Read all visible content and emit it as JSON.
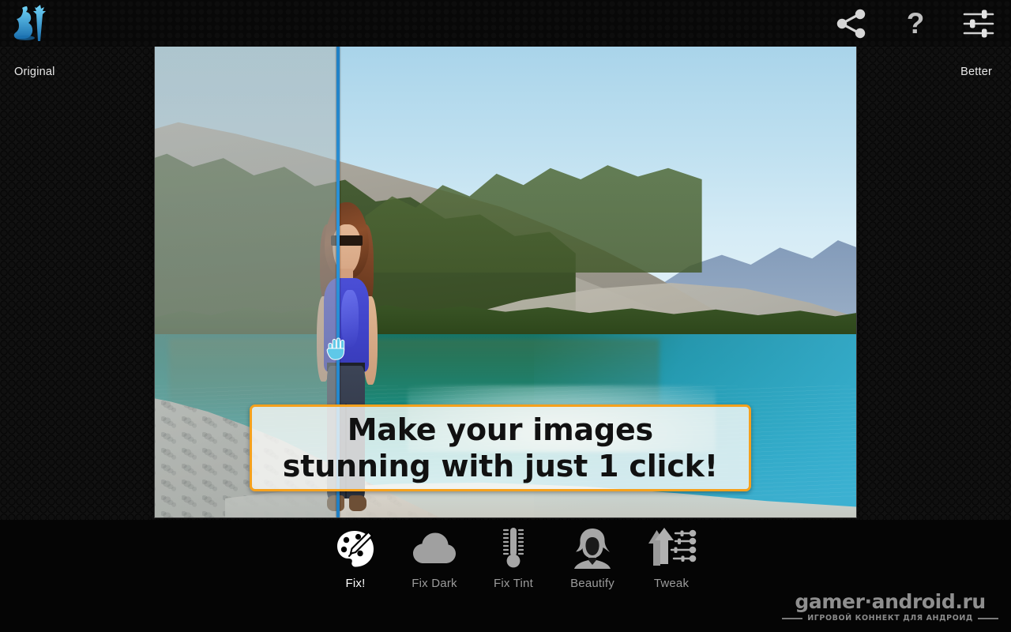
{
  "app": {
    "logo_icon": "mermaid-trident-logo-icon",
    "background_color": "#121212",
    "topbar_color": "#080808",
    "bottombar_color": "#050505",
    "accent_color": "#f5a11d",
    "divider_color": "#2b95dc"
  },
  "topbar": {
    "actions": [
      {
        "name": "share-button",
        "icon": "share-icon",
        "label": "Share"
      },
      {
        "name": "help-button",
        "icon": "question-mark-icon",
        "label": "?"
      },
      {
        "name": "settings-button",
        "icon": "sliders-icon",
        "label": "Settings"
      }
    ]
  },
  "compare": {
    "left_label": "Original",
    "right_label": "Better",
    "divider_position_percent": 26,
    "handle_icon": "hand-drag-icon"
  },
  "banner": {
    "line1": "Make your images",
    "line2": "stunning with just 1 click!",
    "border_color": "#f5a11d",
    "background_color": "rgba(250,250,248,0.80)"
  },
  "toolbar": {
    "items": [
      {
        "label": "Fix!",
        "icon": "palette-brush-icon",
        "active": true
      },
      {
        "label": "Fix Dark",
        "icon": "cloud-icon",
        "active": false
      },
      {
        "label": "Fix Tint",
        "icon": "thermometer-icon",
        "active": false
      },
      {
        "label": "Beautify",
        "icon": "woman-portrait-icon",
        "active": false
      },
      {
        "label": "Tweak",
        "icon": "arrows-sliders-icon",
        "active": false
      }
    ]
  },
  "watermark": {
    "main": "gamer·android.ru",
    "sub": "ИГРОВОЙ КОННЕКТ ДЛЯ АНДРОИД"
  }
}
